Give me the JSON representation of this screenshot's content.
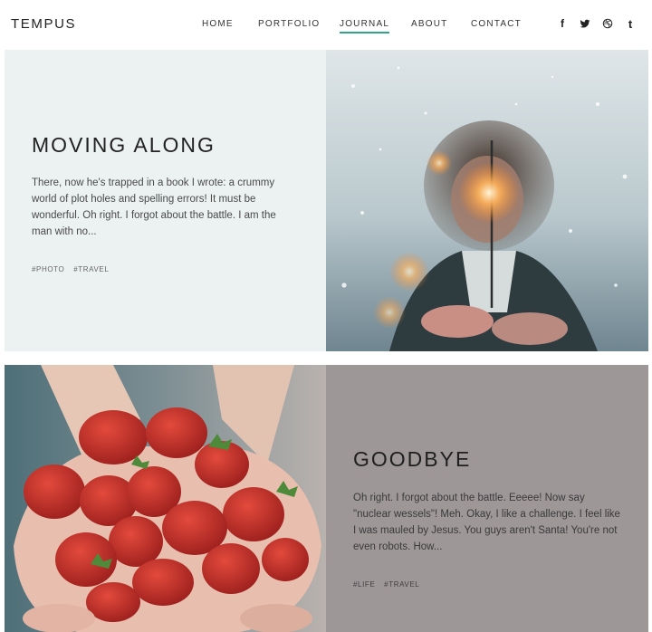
{
  "header": {
    "logo": "TEMPUS",
    "nav": [
      {
        "label": "HOME"
      },
      {
        "label": "PORTFOLIO"
      },
      {
        "label": "JOURNAL"
      },
      {
        "label": "ABOUT"
      },
      {
        "label": "CONTACT"
      }
    ],
    "social": [
      {
        "icon": "facebook-icon",
        "glyph": "f"
      },
      {
        "icon": "twitter-icon",
        "glyph": ""
      },
      {
        "icon": "dribbble-icon",
        "glyph": ""
      },
      {
        "icon": "tumblr-icon",
        "glyph": "t"
      }
    ]
  },
  "posts": [
    {
      "title": "MOVING ALONG",
      "body": "There, now he's trapped in a book I wrote: a crummy world of plot holes and spelling errors! It must be wonderful. Oh right. I forgot about the battle. I am the man with no...",
      "tags": [
        "#PHOTO",
        "#TRAVEL"
      ]
    },
    {
      "title": "GOODBYE",
      "body": "Oh right. I forgot about the battle. Eeeee! Now say \"nuclear wessels\"! Meh. Okay, I like a challenge. I feel like I was mauled by Jesus. You guys aren't Santa! You're not even robots. How...",
      "tags": [
        "#LIFE",
        "#TRAVEL"
      ]
    }
  ],
  "colors": {
    "accent": "#2fa58a",
    "panel_light": "#ecf1f1",
    "panel_mauve": "#9d9798"
  }
}
